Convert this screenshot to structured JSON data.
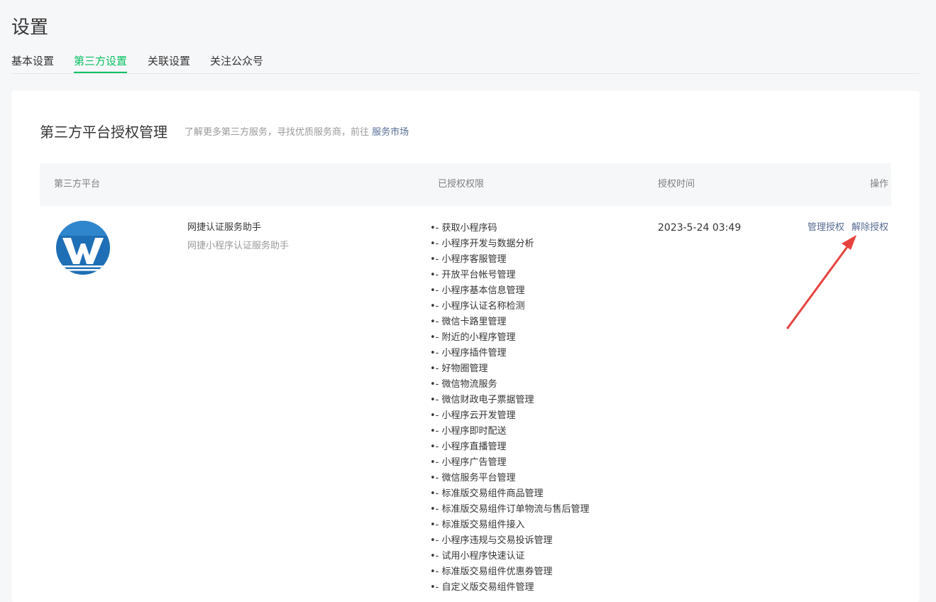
{
  "page": {
    "title": "设置"
  },
  "tabs": [
    {
      "label": "基本设置",
      "active": false
    },
    {
      "label": "第三方设置",
      "active": true
    },
    {
      "label": "关联设置",
      "active": false
    },
    {
      "label": "关注公众号",
      "active": false
    }
  ],
  "section": {
    "title": "第三方平台授权管理",
    "desc": "了解更多第三方服务，寻找优质服务商，前往",
    "market_link": "服务市场"
  },
  "table": {
    "headers": {
      "platform": "第三方平台",
      "permissions": "已授权权限",
      "time": "授权时间",
      "ops": "操作"
    },
    "rows": [
      {
        "logo_icon": "wangjie-logo-icon",
        "name": "网捷认证服务助手",
        "desc": "网捷小程序认证服务助手",
        "permissions": [
          "- 获取小程序码",
          "- 小程序开发与数据分析",
          "- 小程序客服管理",
          "- 开放平台帐号管理",
          "- 小程序基本信息管理",
          "- 小程序认证名称检测",
          "- 微信卡路里管理",
          "- 附近的小程序管理",
          "- 小程序插件管理",
          "- 好物圈管理",
          "- 微信物流服务",
          "- 微信财政电子票据管理",
          "- 小程序云开发管理",
          "- 小程序即时配送",
          "- 小程序直播管理",
          "- 小程序广告管理",
          "- 微信服务平台管理",
          "- 标准版交易组件商品管理",
          "- 标准版交易组件订单物流与售后管理",
          "- 标准版交易组件接入",
          "- 小程序违规与交易投诉管理",
          "- 试用小程序快速认证",
          "- 标准版交易组件优惠券管理",
          "- 自定义版交易组件管理"
        ],
        "time": "2023-5-24 03:49",
        "manage_label": "管理授权",
        "revoke_label": "解除授权"
      }
    ]
  },
  "colors": {
    "accent": "#07c160",
    "link": "#576b95",
    "annotation_arrow": "#e8423f"
  }
}
